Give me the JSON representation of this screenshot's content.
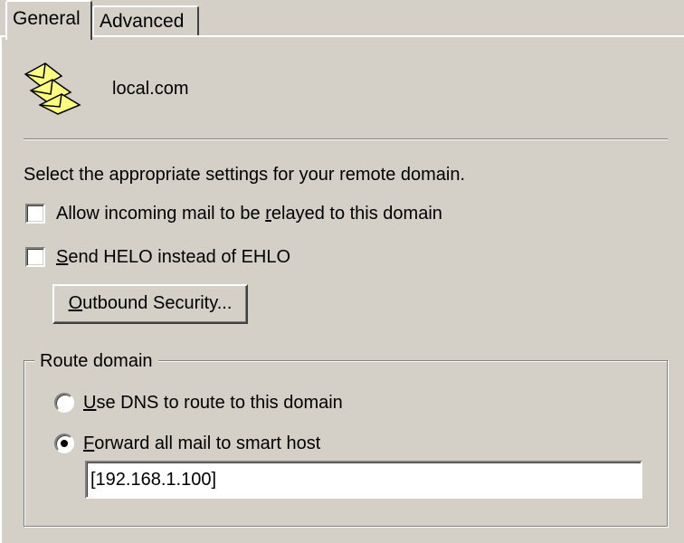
{
  "tabs": {
    "general": "General",
    "advanced": "Advanced"
  },
  "domain": {
    "icon": "envelopes-icon",
    "name": "local.com"
  },
  "instructions": "Select the appropriate settings for your remote domain.",
  "checkboxes": {
    "allow_relay": {
      "label_prefix": "Allow incoming mail to be ",
      "label_accel": "r",
      "label_suffix": "elayed to this domain",
      "checked": false
    },
    "send_helo": {
      "label_prefix": "",
      "label_accel": "S",
      "label_suffix": "end HELO instead of EHLO",
      "checked": false
    }
  },
  "outbound_button": {
    "label_accel": "O",
    "label_suffix": "utbound Security..."
  },
  "route_domain": {
    "legend": "Route domain",
    "use_dns": {
      "label_accel": "U",
      "label_suffix": "se DNS to route to this domain",
      "selected": false
    },
    "forward": {
      "label_accel": "F",
      "label_suffix": "orward all mail to smart host",
      "selected": true
    },
    "smart_host_value": "[192.168.1.100]"
  }
}
